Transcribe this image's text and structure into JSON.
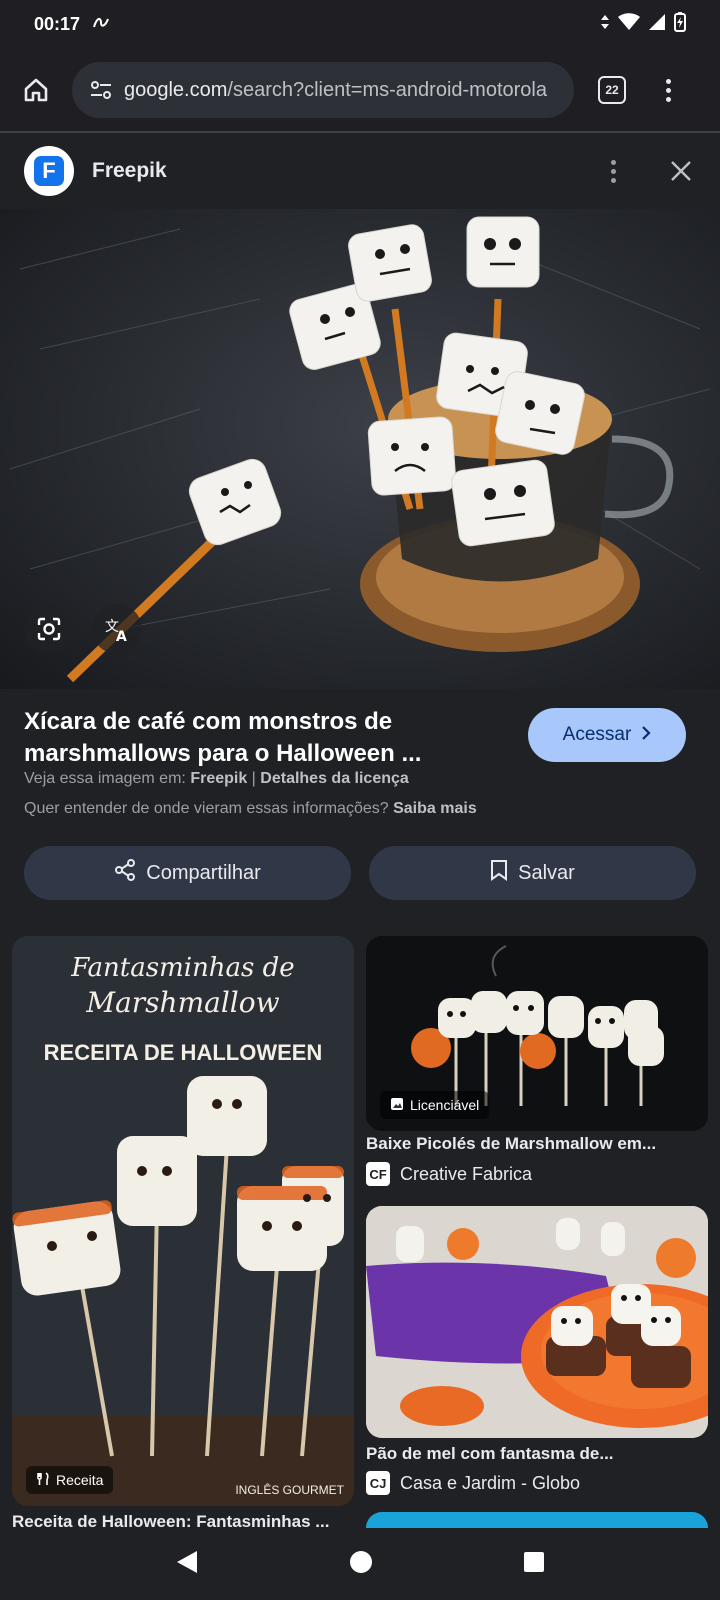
{
  "status": {
    "time": "00:17",
    "notif_icon": "assistant-icon",
    "battery_icon": "battery-charging-icon"
  },
  "browser": {
    "url_host": "google.com",
    "url_path": "/search?client=ms-android-motorola",
    "tab_count": "22"
  },
  "panel": {
    "source_name": "Freepik",
    "source_logo_letter": "F"
  },
  "result": {
    "title": "Xícara de café com monstros de marshmallows para o Halloween ...",
    "visit_label": "Acessar",
    "view_on_prefix": "Veja essa imagem em:",
    "view_on_source": "Freepik",
    "license_link": "Detalhes da licença",
    "info_question": "Quer entender de onde vieram essas informações?",
    "learn_more": "Saiba mais"
  },
  "actions": {
    "share": "Compartilhar",
    "save": "Salvar"
  },
  "grid": {
    "left": {
      "overlay_line1": "Fantasminhas de",
      "overlay_line2": "Marshmallow",
      "overlay_line3": "RECEITA DE HALLOWEEN",
      "watermark": "INGLÊS GOURMET",
      "badge": "Receita",
      "title": "Receita de Halloween: Fantasminhas ..."
    },
    "right1": {
      "badge": "Licenciável",
      "title": "Baixe Picolés de Marshmallow em...",
      "source": "Creative Fabrica",
      "fav": "CF"
    },
    "right2": {
      "title": "Pão de mel com fantasma de...",
      "source": "Casa e Jardim - Globo",
      "fav": "CJ"
    }
  },
  "colors": {
    "accent": "#a8c7fa",
    "background": "#202124",
    "pill": "#303848"
  }
}
